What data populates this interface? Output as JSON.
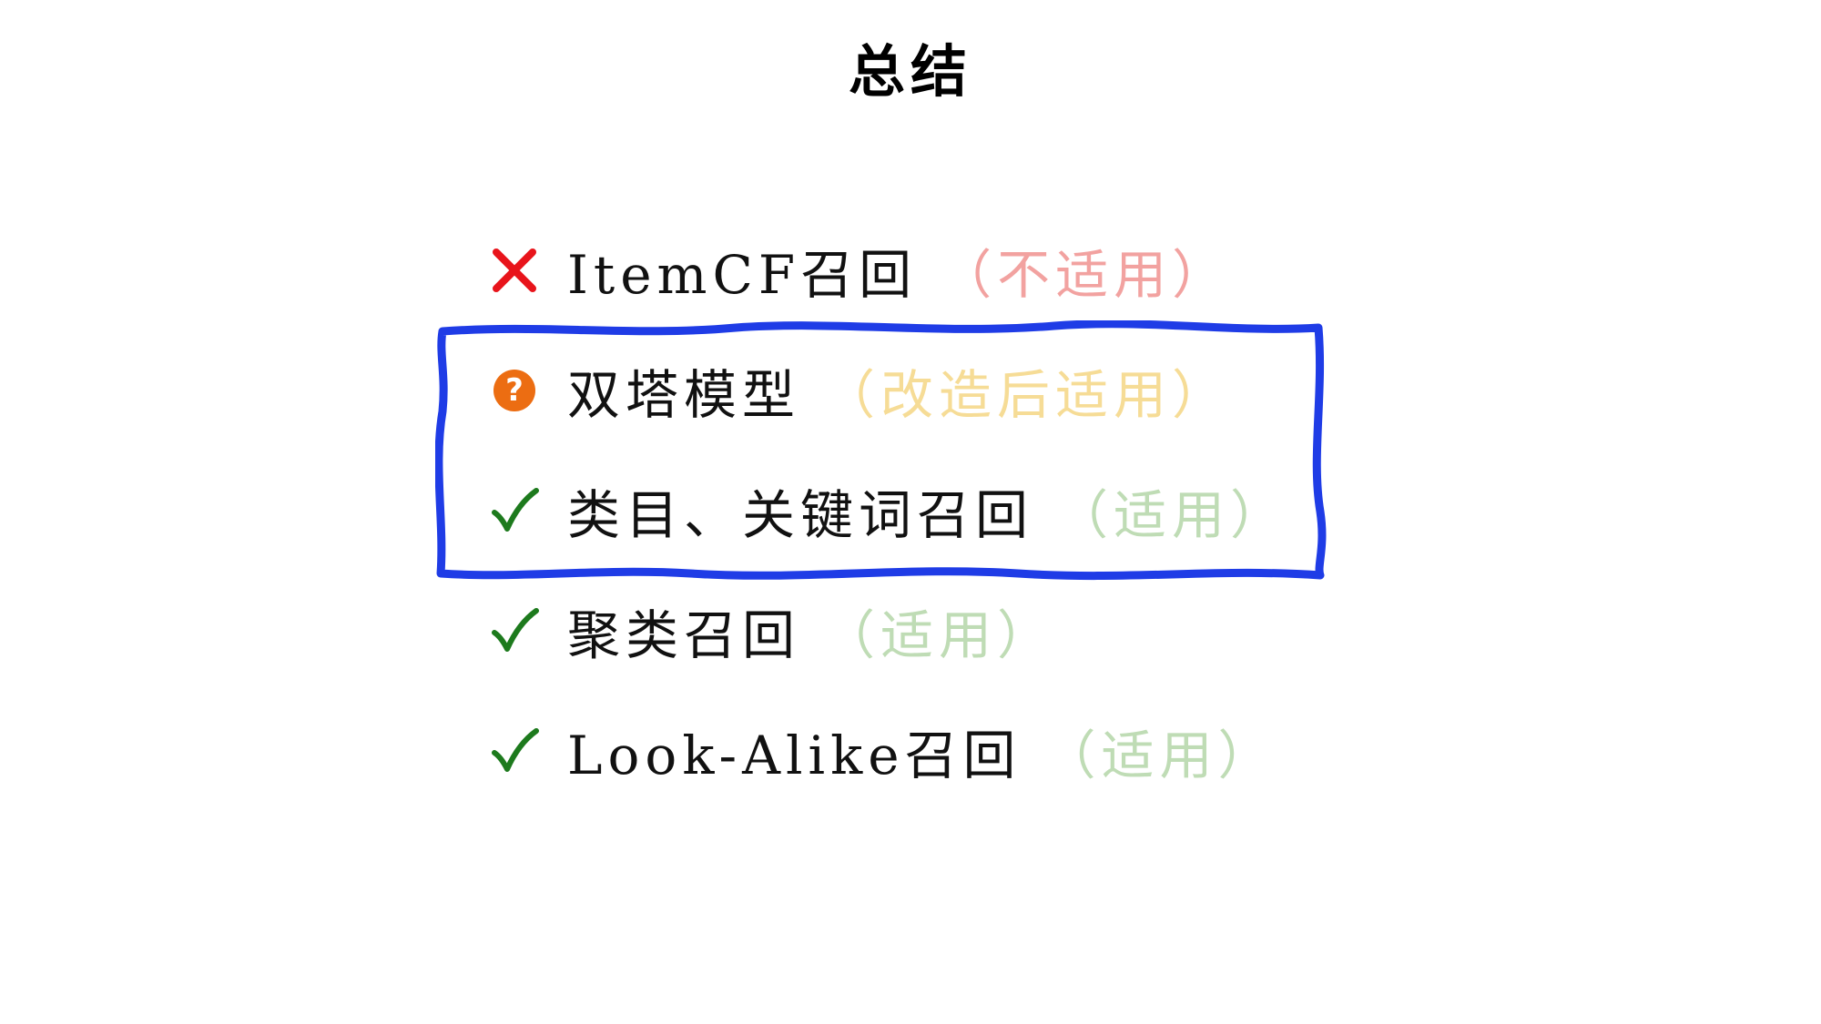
{
  "title": "总结",
  "items": [
    {
      "marker": "cross-icon",
      "label": "ItemCF召回",
      "status": "（不适用）",
      "status_color": "#f2a2a0"
    },
    {
      "marker": "question-icon",
      "label": "双塔模型",
      "status": "（改造后适用）",
      "status_color": "#f6dc96"
    },
    {
      "marker": "check-icon",
      "label": "类目、关键词召回",
      "status": "（适用）",
      "status_color": "#bfdcb5"
    },
    {
      "marker": "check-icon",
      "label": "聚类召回",
      "status": "（适用）",
      "status_color": "#bfdcb5"
    },
    {
      "marker": "check-icon",
      "label": "Look-Alike召回",
      "status": "（适用）",
      "status_color": "#bfdcb5"
    }
  ],
  "question_mark": "?",
  "colors": {
    "cross": "#e8141b",
    "check": "#1d7a1d",
    "question_badge": "#ec6d12",
    "highlight_box": "#1f3ce6"
  }
}
